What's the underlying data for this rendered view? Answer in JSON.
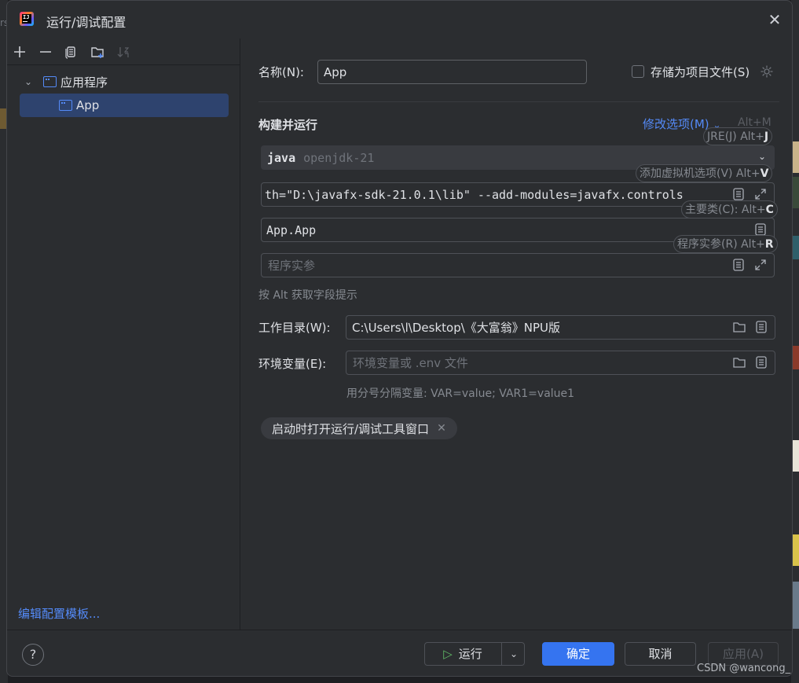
{
  "window": {
    "title": "运行/调试配置",
    "close": "✕"
  },
  "background": {
    "left_text": "rs"
  },
  "left": {
    "toolbar": [
      "add-icon",
      "remove-icon",
      "copy-icon",
      "new-folder-icon",
      "sort-icon"
    ],
    "tree": {
      "group_label": "应用程序",
      "item_label": "App"
    },
    "edit_templates": "编辑配置模板..."
  },
  "form": {
    "name_label": "名称(N):",
    "name_value": "App",
    "store_label": "存储为项目文件(S)",
    "section_title": "构建并运行",
    "modify_options": "修改选项(M)",
    "modify_shortcut": "Alt+M",
    "jre_keyword": "java",
    "jre_value": "openjdk-21",
    "vm_options": "th=\"D:\\javafx-sdk-21.0.1\\lib\" --add-modules=javafx.controls",
    "main_class": "App.App",
    "program_args_placeholder": "程序实参",
    "alt_hint": "按 Alt 获取字段提示",
    "working_dir_label": "工作目录(W):",
    "working_dir_value": "C:\\Users\\l\\Desktop\\《大富翁》NPU版",
    "env_label": "环境变量(E):",
    "env_placeholder": "环境变量或 .env 文件",
    "env_hint": "用分号分隔变量: VAR=value; VAR1=value1",
    "chip_label": "启动时打开运行/调试工具窗口"
  },
  "hints": {
    "jre": {
      "text": "JRE(J) Alt+",
      "key": "J"
    },
    "vm": {
      "text": "添加虚拟机选项(V) Alt+",
      "key": "V"
    },
    "main": {
      "text": "主要类(C): Alt+",
      "key": "C"
    },
    "args": {
      "text": "程序实参(R) Alt+",
      "key": "R"
    }
  },
  "buttons": {
    "help": "?",
    "run": "运行",
    "ok": "确定",
    "cancel": "取消",
    "apply": "应用(A)"
  },
  "watermark": "CSDN @wancong_",
  "colors": {
    "accent": "#3574f0",
    "link": "#548af7",
    "selection": "#2e436e",
    "bg": "#2b2d30"
  }
}
